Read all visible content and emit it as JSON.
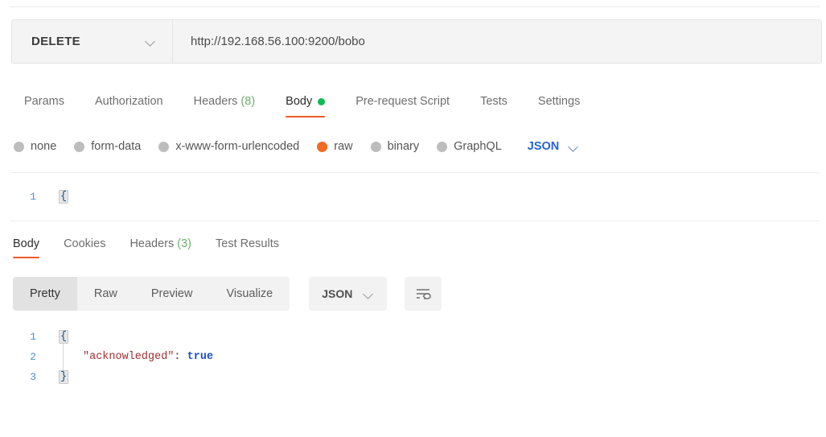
{
  "request": {
    "method": "DELETE",
    "method_chevron_icon": "chevron-down-icon",
    "url": "http://192.168.56.100:9200/bobo",
    "tabs": [
      {
        "label": "Params",
        "active": false
      },
      {
        "label": "Authorization",
        "active": false
      },
      {
        "label": "Headers",
        "count": "(8)",
        "active": false
      },
      {
        "label": "Body",
        "active": true,
        "dot": true
      },
      {
        "label": "Pre-request Script",
        "active": false
      },
      {
        "label": "Tests",
        "active": false
      },
      {
        "label": "Settings",
        "active": false
      }
    ],
    "body_types": [
      {
        "label": "none",
        "selected": false
      },
      {
        "label": "form-data",
        "selected": false
      },
      {
        "label": "x-www-form-urlencoded",
        "selected": false
      },
      {
        "label": "raw",
        "selected": true
      },
      {
        "label": "binary",
        "selected": false
      },
      {
        "label": "GraphQL",
        "selected": false
      }
    ],
    "raw_format": "JSON",
    "raw_format_chevron_icon": "chevron-down-icon",
    "editor": {
      "lines": [
        {
          "number": "1",
          "text": "{"
        }
      ]
    }
  },
  "response": {
    "tabs": [
      {
        "label": "Body",
        "active": true
      },
      {
        "label": "Cookies",
        "active": false
      },
      {
        "label": "Headers",
        "count": "(3)",
        "active": false
      },
      {
        "label": "Test Results",
        "active": false
      }
    ],
    "view_modes": [
      {
        "label": "Pretty",
        "active": true
      },
      {
        "label": "Raw",
        "active": false
      },
      {
        "label": "Preview",
        "active": false
      },
      {
        "label": "Visualize",
        "active": false
      }
    ],
    "format": "JSON",
    "format_chevron_icon": "chevron-down-icon",
    "wrap_icon": "word-wrap-icon",
    "body": {
      "lines": [
        {
          "number": "1",
          "kind": "brace",
          "text": "{"
        },
        {
          "number": "2",
          "kind": "pair",
          "key": "\"acknowledged\"",
          "colon": ":",
          "value": "true"
        },
        {
          "number": "3",
          "kind": "brace",
          "text": "}"
        }
      ]
    }
  },
  "colors": {
    "accent_orange": "#ef5b25",
    "radio_selected": "#f26b21",
    "body_dot_green": "#0cbb52",
    "count_green": "#6cb26c",
    "link_blue": "#2563d9",
    "json_key_red": "#a03030",
    "json_bool_blue": "#1a4fc4"
  }
}
